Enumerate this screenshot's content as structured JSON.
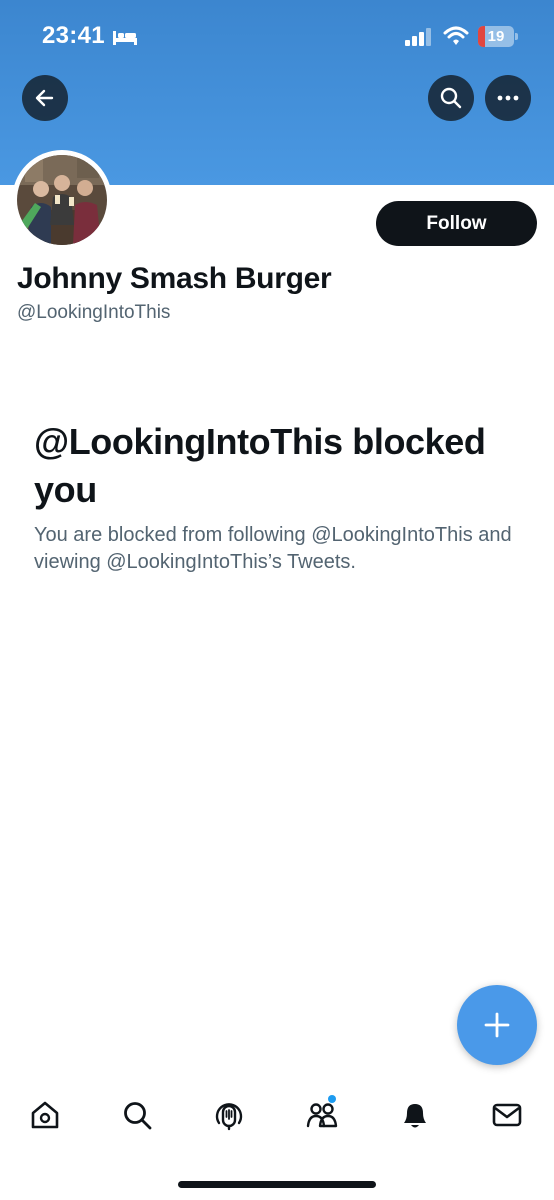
{
  "status_bar": {
    "time": "23:41",
    "battery_level": "19",
    "battery_fraction": 0.19,
    "icons": [
      "bed-icon",
      "cellular-signal-icon",
      "wifi-icon",
      "battery-icon"
    ]
  },
  "header": {
    "banner_color": "#4a98e2",
    "buttons": [
      "back-arrow-icon",
      "search-icon",
      "more-icon"
    ]
  },
  "profile": {
    "display_name": "Johnny Smash Burger",
    "handle": "@LookingIntoThis",
    "follow_label": "Follow"
  },
  "blocked_notice": {
    "title": "@LookingIntoThis blocked you",
    "description": "You are blocked from following @LookingIntoThis and viewing @LookingIntoThis’s Tweets."
  },
  "compose": {
    "icon": "plus-icon",
    "color": "#4a99e9"
  },
  "tab_bar": {
    "items": [
      "home-icon",
      "search-icon",
      "spaces-icon",
      "communities-icon",
      "notifications-icon",
      "messages-icon"
    ],
    "notification_dot_color": "#1d9bf0"
  },
  "colors": {
    "primary_text": "#0f1419",
    "secondary_text": "#536471",
    "accent": "#1d9bf0"
  }
}
